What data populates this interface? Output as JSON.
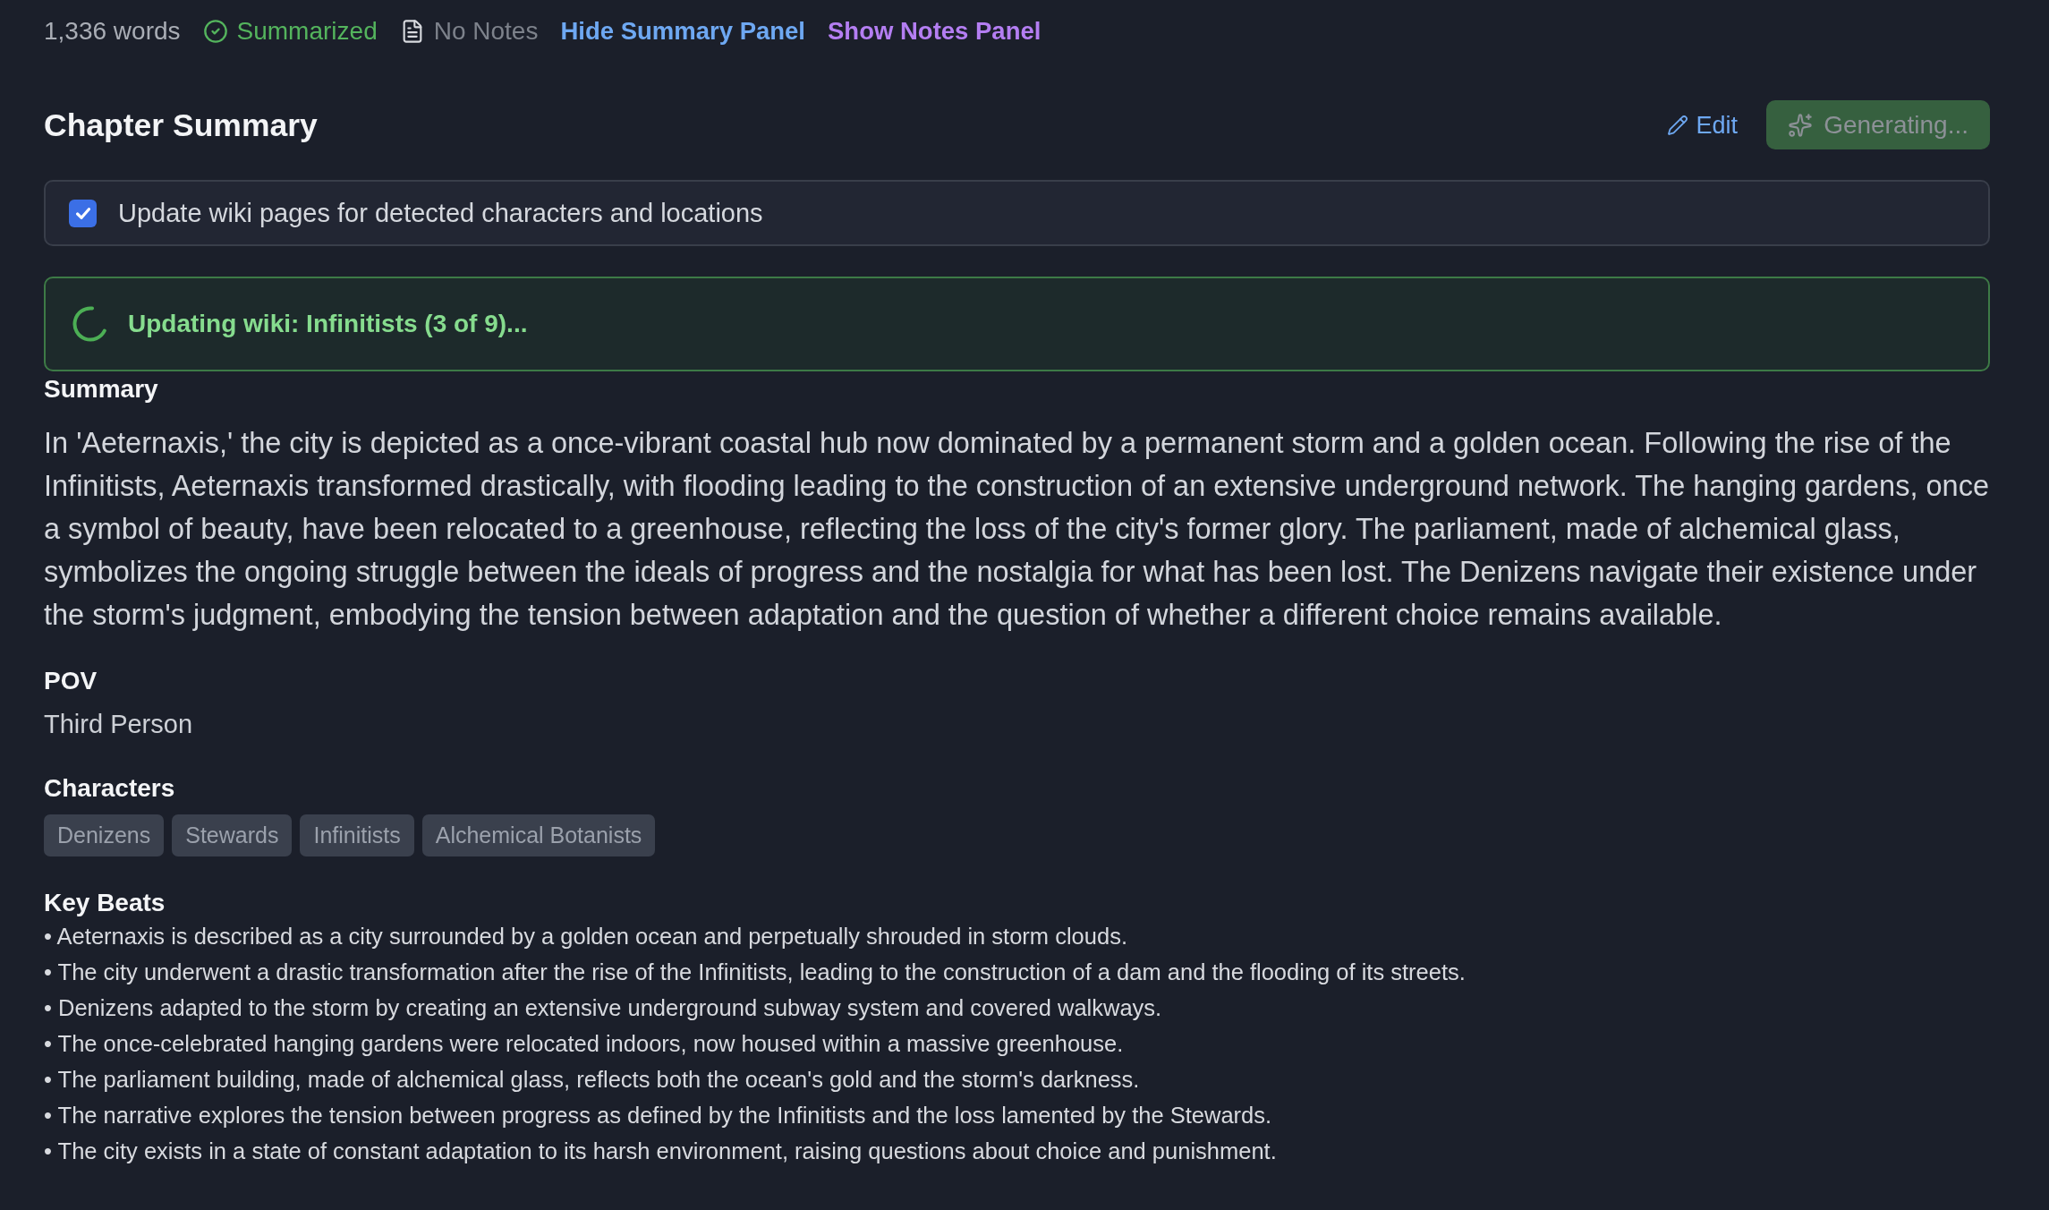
{
  "meta_bar": {
    "word_count": "1,336 words",
    "status": {
      "label": "Summarized",
      "summarized": true
    },
    "notes": {
      "label": "No Notes"
    },
    "links": [
      {
        "label": "Hide Summary Panel",
        "color": "#6ea8f2"
      },
      {
        "label": "Show Notes Panel",
        "color": "#b47ef2"
      }
    ]
  },
  "header": {
    "title": "Chapter Summary",
    "edit_button": {
      "label": "Edit"
    },
    "generate_button": {
      "label": "Generating...",
      "disabled": true
    }
  },
  "wiki_option": {
    "label": "Update wiki pages for detected characters and locations",
    "checked": true
  },
  "progress": {
    "message": "Updating wiki: Infinitists (3 of 9)..."
  },
  "summary": {
    "heading": "Summary",
    "text": "In 'Aeternaxis,' the city is depicted as a once-vibrant coastal hub now dominated by a permanent storm and a golden ocean. Following the rise of the Infinitists, Aeternaxis transformed drastically, with flooding leading to the construction of an extensive underground network. The hanging gardens, once a symbol of beauty, have been relocated to a greenhouse, reflecting the loss of the city's former glory. The parliament, made of alchemical glass, symbolizes the ongoing struggle between the ideals of progress and the nostalgia for what has been lost. The Denizens navigate their existence under the storm's judgment, embodying the tension between adaptation and the question of whether a different choice remains available."
  },
  "pov": {
    "heading": "POV",
    "value": "Third Person"
  },
  "characters": {
    "heading": "Characters",
    "tags": [
      "Denizens",
      "Stewards",
      "Infinitists",
      "Alchemical Botanists"
    ]
  },
  "key_beats": {
    "heading": "Key Beats",
    "items": [
      "• Aeternaxis is described as a city surrounded by a golden ocean and perpetually shrouded in storm clouds.",
      "• The city underwent a drastic transformation after the rise of the Infinitists, leading to the construction of a dam and the flooding of its streets.",
      "• Denizens adapted to the storm by creating an extensive underground subway system and covered walkways.",
      "• The once-celebrated hanging gardens were relocated indoors, now housed within a massive greenhouse.",
      "• The parliament building, made of alchemical glass, reflects both the ocean's gold and the storm's darkness.",
      "• The narrative explores the tension between progress as defined by the Infinitists and the loss lamented by the Stewards.",
      "• The city exists in a state of constant adaptation to its harsh environment, raising questions about choice and punishment."
    ]
  }
}
